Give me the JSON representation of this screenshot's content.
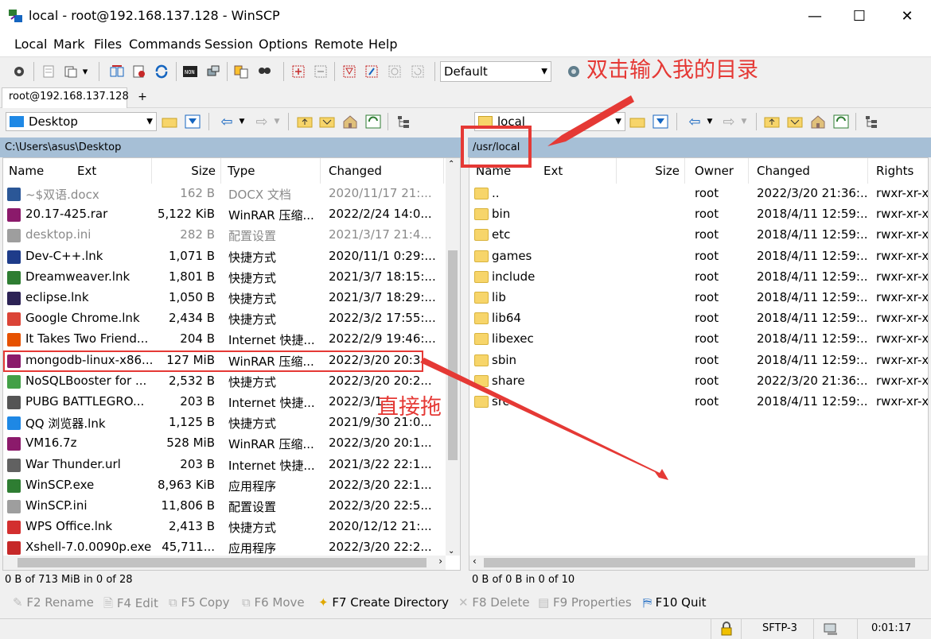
{
  "window": {
    "title": "local - root@192.168.137.128 - WinSCP",
    "minimize": "—",
    "maximize": "☐",
    "close": "✕"
  },
  "menu": [
    "Local",
    "Mark",
    "Files",
    "Commands",
    "Session",
    "Options",
    "Remote",
    "Help"
  ],
  "toolbar": {
    "transfer_preset": "Default"
  },
  "tabs": {
    "session": "root@192.168.137.128",
    "new_tab": "+"
  },
  "left": {
    "drive": "Desktop",
    "path": "C:\\Users\\asus\\Desktop",
    "columns": [
      "Name",
      "Ext",
      "Size",
      "Type",
      "Changed"
    ],
    "files": [
      {
        "name": "~$双语.docx",
        "size": "162 B",
        "type": "DOCX 文档",
        "changed": "2020/11/17  21:...",
        "hidden": true,
        "icon": "word-doc-icon",
        "color": "#2b5797"
      },
      {
        "name": "20.17-425.rar",
        "size": "5,122 KiB",
        "type": "WinRAR 压缩...",
        "changed": "2022/2/24  14:0...",
        "icon": "winrar-icon",
        "color": "#8b1a6b"
      },
      {
        "name": "desktop.ini",
        "size": "282 B",
        "type": "配置设置",
        "changed": "2021/3/17  21:4...",
        "hidden": true,
        "icon": "ini-file-icon",
        "color": "#9e9e9e"
      },
      {
        "name": "Dev-C++.lnk",
        "size": "1,071 B",
        "type": "快捷方式",
        "changed": "2020/11/1  0:29:...",
        "icon": "devcpp-icon",
        "color": "#1e3c8a"
      },
      {
        "name": "Dreamweaver.lnk",
        "size": "1,801 B",
        "type": "快捷方式",
        "changed": "2021/3/7  18:15:...",
        "icon": "dreamweaver-icon",
        "color": "#2e7d32"
      },
      {
        "name": "eclipse.lnk",
        "size": "1,050 B",
        "type": "快捷方式",
        "changed": "2021/3/7  18:29:...",
        "icon": "eclipse-icon",
        "color": "#2c2255"
      },
      {
        "name": "Google Chrome.lnk",
        "size": "2,434 B",
        "type": "快捷方式",
        "changed": "2022/3/2  17:55:...",
        "icon": "chrome-icon",
        "color": "#db4437"
      },
      {
        "name": "It Takes Two Friend...",
        "size": "204 B",
        "type": "Internet 快捷...",
        "changed": "2022/2/9  19:46:...",
        "icon": "game-icon",
        "color": "#e65100"
      },
      {
        "name": "mongodb-linux-x86...",
        "size": "127 MiB",
        "type": "WinRAR 压缩...",
        "changed": "2022/3/20  20:3...",
        "icon": "winrar-icon",
        "color": "#8b1a6b"
      },
      {
        "name": "NoSQLBooster for ...",
        "size": "2,532 B",
        "type": "快捷方式",
        "changed": "2022/3/20  20:2...",
        "icon": "nosqlbooster-icon",
        "color": "#43a047"
      },
      {
        "name": "PUBG BATTLEGRO...",
        "size": "203 B",
        "type": "Internet 快捷...",
        "changed": "2022/3/1...",
        "icon": "pubg-icon",
        "color": "#555555"
      },
      {
        "name": "QQ 浏览器.lnk",
        "size": "1,125 B",
        "type": "快捷方式",
        "changed": "2021/9/30  21:0...",
        "icon": "qq-browser-icon",
        "color": "#1e88e5"
      },
      {
        "name": "VM16.7z",
        "size": "528 MiB",
        "type": "WinRAR 压缩...",
        "changed": "2022/3/20  20:1...",
        "icon": "winrar-icon",
        "color": "#8b1a6b"
      },
      {
        "name": "War Thunder.url",
        "size": "203 B",
        "type": "Internet 快捷...",
        "changed": "2021/3/22  22:1...",
        "icon": "war-thunder-icon",
        "color": "#616161"
      },
      {
        "name": "WinSCP.exe",
        "size": "8,963 KiB",
        "type": "应用程序",
        "changed": "2022/3/20  22:1...",
        "icon": "winscp-icon",
        "color": "#2e7d32"
      },
      {
        "name": "WinSCP.ini",
        "size": "11,806 B",
        "type": "配置设置",
        "changed": "2022/3/20  22:5...",
        "icon": "ini-file-icon",
        "color": "#9e9e9e"
      },
      {
        "name": "WPS Office.lnk",
        "size": "2,413 B",
        "type": "快捷方式",
        "changed": "2020/12/12  21:...",
        "icon": "wps-icon",
        "color": "#d32f2f"
      },
      {
        "name": "Xshell-7.0.0090p.exe",
        "size": "45,711...",
        "type": "应用程序",
        "changed": "2022/3/20  22:2...",
        "icon": "xshell-icon",
        "color": "#c62828"
      }
    ],
    "status": "0 B of 713 MiB in 0 of 28"
  },
  "right": {
    "drive": "local",
    "path": "/usr/local",
    "columns": [
      "Name",
      "Ext",
      "Size",
      "Owner",
      "Changed",
      "Rights"
    ],
    "files": [
      {
        "name": "..",
        "owner": "root",
        "changed": "2022/3/20 21:36:...",
        "rights": "rwxr-xr-x",
        "up": true
      },
      {
        "name": "bin",
        "owner": "root",
        "changed": "2018/4/11 12:59:...",
        "rights": "rwxr-xr-x"
      },
      {
        "name": "etc",
        "owner": "root",
        "changed": "2018/4/11 12:59:...",
        "rights": "rwxr-xr-x"
      },
      {
        "name": "games",
        "owner": "root",
        "changed": "2018/4/11 12:59:...",
        "rights": "rwxr-xr-x"
      },
      {
        "name": "include",
        "owner": "root",
        "changed": "2018/4/11 12:59:...",
        "rights": "rwxr-xr-x"
      },
      {
        "name": "lib",
        "owner": "root",
        "changed": "2018/4/11 12:59:...",
        "rights": "rwxr-xr-x"
      },
      {
        "name": "lib64",
        "owner": "root",
        "changed": "2018/4/11 12:59:...",
        "rights": "rwxr-xr-x"
      },
      {
        "name": "libexec",
        "owner": "root",
        "changed": "2018/4/11 12:59:...",
        "rights": "rwxr-xr-x"
      },
      {
        "name": "sbin",
        "owner": "root",
        "changed": "2018/4/11 12:59:...",
        "rights": "rwxr-xr-x"
      },
      {
        "name": "share",
        "owner": "root",
        "changed": "2022/3/20 21:36:...",
        "rights": "rwxr-xr-x"
      },
      {
        "name": "src",
        "owner": "root",
        "changed": "2018/4/11 12:59:...",
        "rights": "rwxr-xr-x"
      }
    ],
    "status": "0 B of 0 B in 0 of 10"
  },
  "fkeys": [
    {
      "label": "F2 Rename",
      "enabled": false
    },
    {
      "label": "F4 Edit",
      "enabled": false
    },
    {
      "label": "F5 Copy",
      "enabled": false
    },
    {
      "label": "F6 Move",
      "enabled": false
    },
    {
      "label": "F7 Create Directory",
      "enabled": true
    },
    {
      "label": "F8 Delete",
      "enabled": false
    },
    {
      "label": "F9 Properties",
      "enabled": false
    },
    {
      "label": "F10 Quit",
      "enabled": true
    }
  ],
  "statusbar": {
    "protocol": "SFTP-3",
    "elapsed": "0:01:17"
  },
  "annotations": {
    "double_click_note": "双击输入我的目录",
    "drag_note": "直接拖",
    "color": "#e53935"
  }
}
